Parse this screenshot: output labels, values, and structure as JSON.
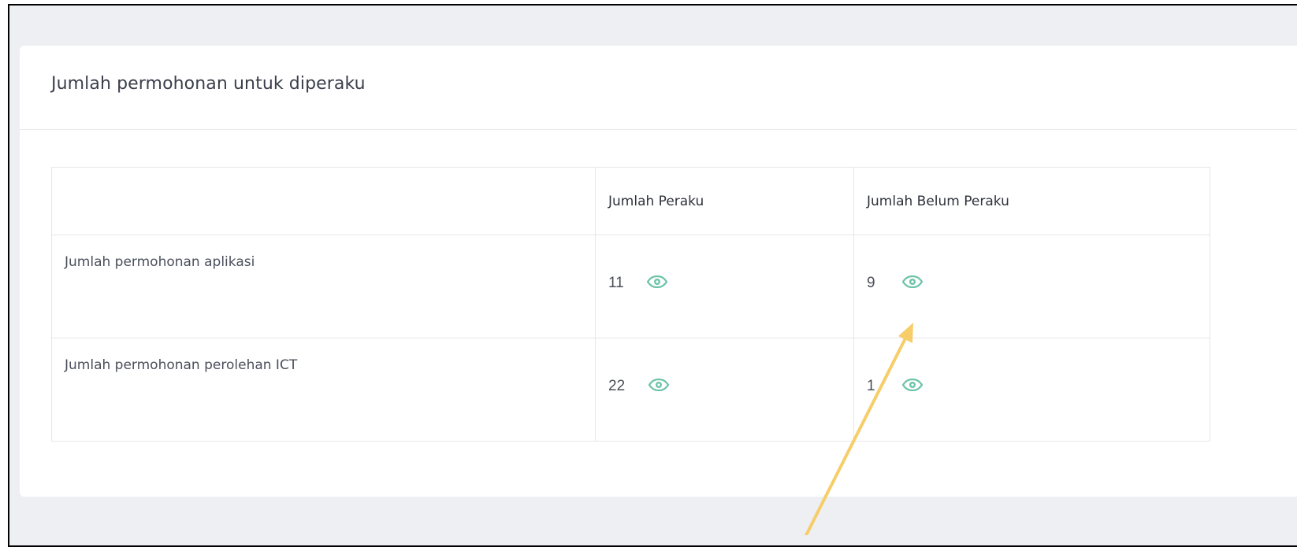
{
  "card": {
    "title": "Jumlah permohonan untuk diperaku"
  },
  "table": {
    "headers": [
      "",
      "Jumlah Peraku",
      "Jumlah Belum Peraku"
    ],
    "rows": [
      {
        "label": "Jumlah permohonan aplikasi",
        "peraku": "11",
        "belum_peraku": "9"
      },
      {
        "label": "Jumlah permohonan perolehan ICT",
        "peraku": "22",
        "belum_peraku": "1"
      }
    ]
  },
  "icons": {
    "view": "eye-icon"
  },
  "colors": {
    "eye": "#6cc3a8",
    "arrow": "#f7cd6a",
    "frame_border": "#000000",
    "page_bg": "#eeeff3"
  }
}
